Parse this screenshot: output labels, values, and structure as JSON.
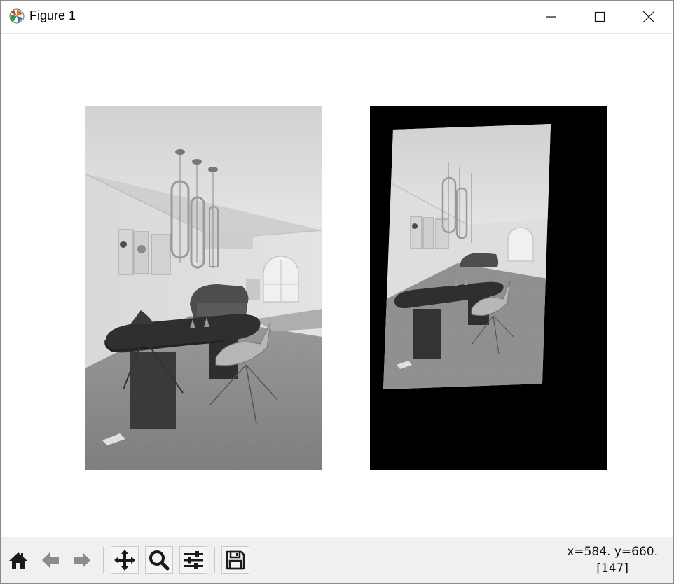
{
  "window": {
    "title": "Figure 1",
    "icon": "matplotlib-icon"
  },
  "window_controls": {
    "minimize": "minimize-icon",
    "maximize": "maximize-icon",
    "close": "close-icon"
  },
  "figure": {
    "panels": [
      {
        "name": "original-image",
        "content": "grayscale dining room photo"
      },
      {
        "name": "rotated-image",
        "content": "rotated grayscale dining room photo on black background"
      }
    ]
  },
  "toolbar": {
    "buttons": [
      "home-icon",
      "back-icon",
      "forward-icon",
      "pan-icon",
      "zoom-icon",
      "configure-subplots-icon",
      "save-icon"
    ]
  },
  "status": {
    "coords": "x=584. y=660.",
    "value": "[147]"
  },
  "colors": {
    "toolbar_bg": "#f0f0f0",
    "icon": "#1a1a1a",
    "icon_disabled": "#8c8c8c",
    "image_bg": "#000000"
  }
}
